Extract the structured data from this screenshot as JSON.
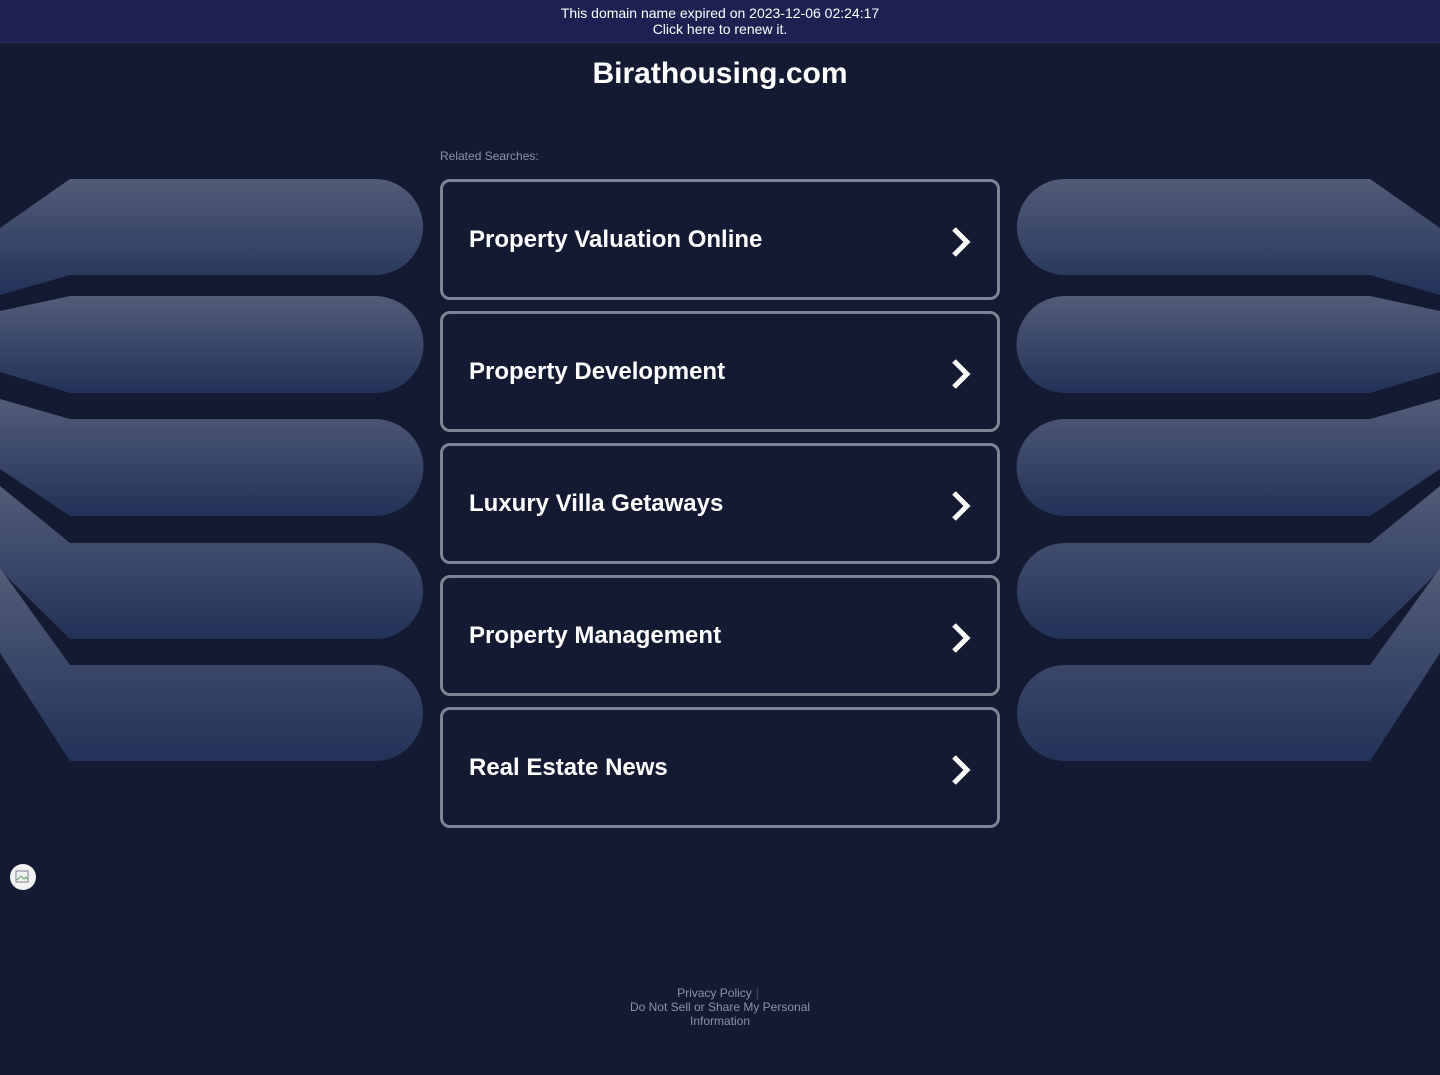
{
  "banner": {
    "expired_text": "This domain name expired on 2023-12-06 02:24:17",
    "renew_link": "Click here to renew it."
  },
  "site": {
    "title": "Birathousing.com"
  },
  "related": {
    "heading": "Related Searches:",
    "items": [
      {
        "label": "Property Valuation Online"
      },
      {
        "label": "Property Development"
      },
      {
        "label": "Luxury Villa Getaways"
      },
      {
        "label": "Property Management"
      },
      {
        "label": "Real Estate News"
      }
    ]
  },
  "footer": {
    "privacy": "Privacy Policy",
    "separator": "|",
    "do_not_sell": "Do Not Sell or Share My Personal Information"
  },
  "colors": {
    "background": "#131a31",
    "banner": "#1c2152",
    "item_border": "#7f8393",
    "muted_text": "#8c93a8",
    "decor_light": "#4e5874",
    "decor_dark": "#22315a"
  },
  "icons": {
    "item_arrow": "chevron-right-icon",
    "badge": "logo-icon"
  }
}
